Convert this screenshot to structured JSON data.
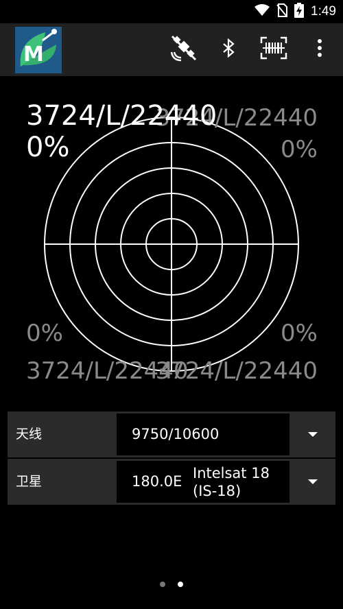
{
  "status_bar": {
    "time": "1:49",
    "icons": [
      "wifi-icon",
      "no-sim-icon",
      "battery-charging-icon"
    ]
  },
  "app_bar": {
    "logo": "app-logo-satellite-dish",
    "actions": [
      "satellite-off-icon",
      "bluetooth-icon",
      "barcode-scan-icon",
      "more-vert-icon"
    ]
  },
  "radar": {
    "top_left_label": "3724/L/22440",
    "top_left_pct": "0%",
    "top_right_label": "3724/L/22440",
    "top_right_pct": "0%",
    "bottom_left_pct": "0%",
    "bottom_right_pct": "0%",
    "bottom_left_label": "3724/L/22440",
    "bottom_right_label": "3724/L/22440"
  },
  "antenna": {
    "label": "天线",
    "value": "9750/10600"
  },
  "satellite": {
    "label": "卫星",
    "position": "180.0E",
    "name_line1": "Intelsat 18",
    "name_line2": "(IS-18)"
  },
  "pager": {
    "pages": 2,
    "active": 2
  },
  "colors": {
    "background": "#000000",
    "app_bar": "#212121",
    "row_background": "#2b2b2b",
    "dim_text": "#8a8a8a",
    "logo_bg": "#1f5a8a",
    "logo_green": "#3ec27a"
  }
}
